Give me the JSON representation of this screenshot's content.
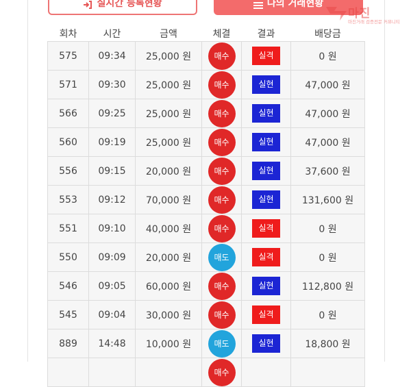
{
  "header": {
    "left_button": {
      "icon": "login-arrow-icon",
      "label": "실시간 등록현황"
    },
    "right_button": {
      "icon": "list-icon",
      "label": "나의 거래현황"
    }
  },
  "logo": {
    "name": "마진",
    "tagline": "마진거래 검증전문 커뮤니티"
  },
  "colors": {
    "buy": "#e02828",
    "sell": "#22a4dc",
    "hit": "#1c25d4",
    "miss": "#ef1c1c",
    "accent": "#f36b6b"
  },
  "table": {
    "columns": [
      "회차",
      "시간",
      "금액",
      "체결",
      "결과",
      "배당금"
    ],
    "rows": [
      {
        "round": "575",
        "time": "09:34",
        "amount": "25,000 원",
        "trade": "매수",
        "result": "실격",
        "payout": "0 원"
      },
      {
        "round": "571",
        "time": "09:30",
        "amount": "25,000 원",
        "trade": "매수",
        "result": "실현",
        "payout": "47,000 원"
      },
      {
        "round": "566",
        "time": "09:25",
        "amount": "25,000 원",
        "trade": "매수",
        "result": "실현",
        "payout": "47,000 원"
      },
      {
        "round": "560",
        "time": "09:19",
        "amount": "25,000 원",
        "trade": "매수",
        "result": "실현",
        "payout": "47,000 원"
      },
      {
        "round": "556",
        "time": "09:15",
        "amount": "20,000 원",
        "trade": "매수",
        "result": "실현",
        "payout": "37,600 원"
      },
      {
        "round": "553",
        "time": "09:12",
        "amount": "70,000 원",
        "trade": "매수",
        "result": "실현",
        "payout": "131,600 원"
      },
      {
        "round": "551",
        "time": "09:10",
        "amount": "40,000 원",
        "trade": "매수",
        "result": "실격",
        "payout": "0 원"
      },
      {
        "round": "550",
        "time": "09:09",
        "amount": "20,000 원",
        "trade": "매도",
        "result": "실격",
        "payout": "0 원"
      },
      {
        "round": "546",
        "time": "09:05",
        "amount": "60,000 원",
        "trade": "매수",
        "result": "실현",
        "payout": "112,800 원"
      },
      {
        "round": "545",
        "time": "09:04",
        "amount": "30,000 원",
        "trade": "매수",
        "result": "실격",
        "payout": "0 원"
      },
      {
        "round": "889",
        "time": "14:48",
        "amount": "10,000 원",
        "trade": "매도",
        "result": "실현",
        "payout": "18,800 원"
      },
      {
        "round": "",
        "time": "",
        "amount": "",
        "trade": "매수",
        "result": "",
        "payout": ""
      }
    ]
  }
}
